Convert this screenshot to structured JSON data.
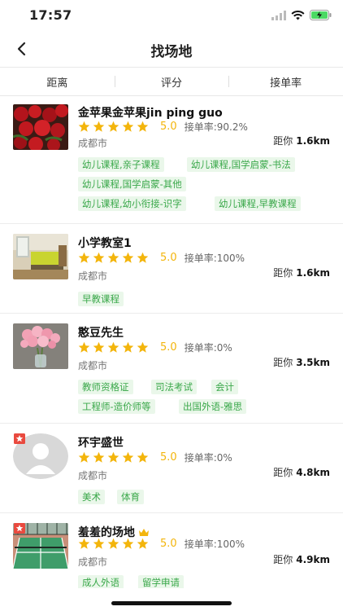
{
  "status": {
    "time": "17:57"
  },
  "nav": {
    "title": "找场地"
  },
  "sort": {
    "tabs": [
      "距离",
      "评分",
      "接单率"
    ]
  },
  "colors": {
    "accent_green": "#3aa84a",
    "tag_bg": "#eaf7ea",
    "star": "#f3b50c",
    "badge_red": "#e94a3f"
  },
  "venues": [
    {
      "name": "金苹果金苹果jin ping guo",
      "score": "5.0",
      "rate": "接单率:90.2%",
      "city": "成都市",
      "dist_label": "距你",
      "distance": "1.6km",
      "image": "roses-image",
      "tags": [
        "幼儿课程,亲子课程",
        "幼儿课程,国学启蒙-书法",
        "幼儿课程,国学启蒙-其他",
        "幼儿课程,幼小衔接-识字",
        "幼儿课程,早教课程"
      ]
    },
    {
      "name": "小学教室1",
      "score": "5.0",
      "rate": "接单率:100%",
      "city": "成都市",
      "dist_label": "距你",
      "distance": "1.6km",
      "image": "room-image",
      "tags": [
        "早教课程"
      ]
    },
    {
      "name": "憨豆先生",
      "score": "5.0",
      "rate": "接单率:0%",
      "city": "成都市",
      "dist_label": "距你",
      "distance": "3.5km",
      "image": "flowers-vase-image",
      "tags": [
        "教师资格证",
        "司法考试",
        "会计",
        "工程师-造价师等",
        "出国外语-雅思"
      ]
    },
    {
      "name": "环宇盛世",
      "score": "5.0",
      "rate": "接单率:0%",
      "city": "成都市",
      "dist_label": "距你",
      "distance": "4.8km",
      "image": "default-avatar",
      "badge": true,
      "tags": [
        "美术",
        "体育"
      ]
    },
    {
      "name": "羞羞的场地",
      "score": "5.0",
      "rate": "接单率:100%",
      "city": "成都市",
      "dist_label": "距你",
      "distance": "4.9km",
      "image": "tennis-court-image",
      "badge": true,
      "crown": true,
      "tags": [
        "成人外语",
        "留学申请"
      ]
    }
  ]
}
